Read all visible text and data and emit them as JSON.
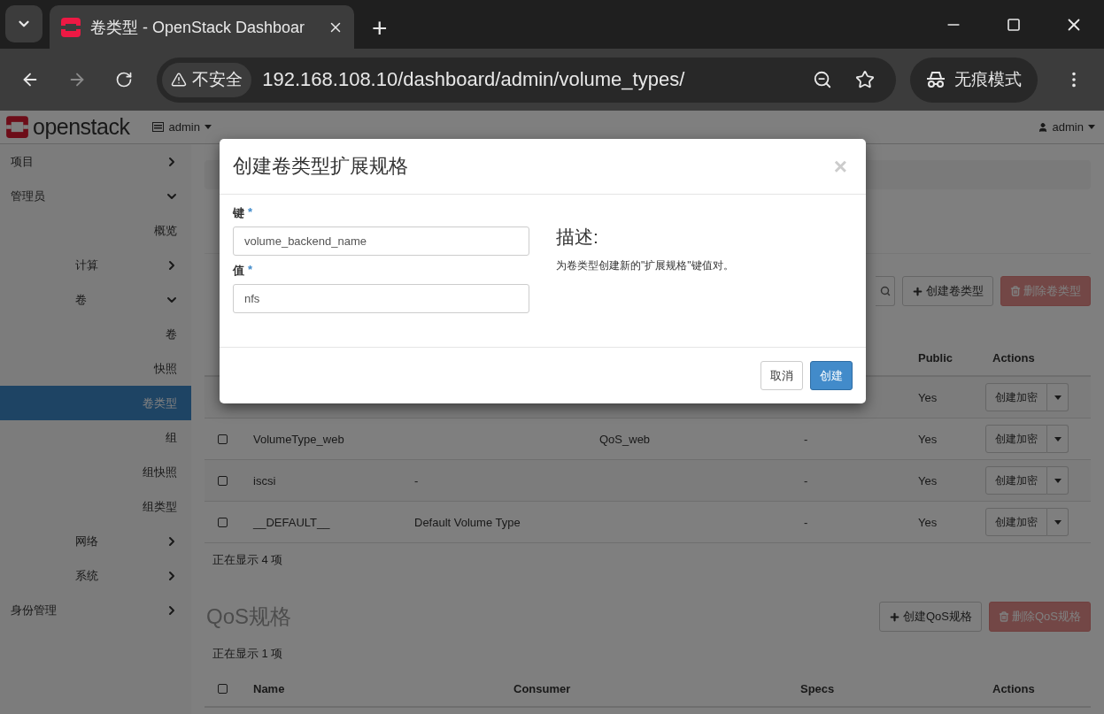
{
  "browser": {
    "tab_title": "卷类型 - OpenStack Dashboar",
    "new_tab": "+",
    "address_warning": "不安全",
    "url": "192.168.108.10/dashboard/admin/volume_types/",
    "incognito": "无痕模式"
  },
  "header": {
    "logo": "openstack",
    "project": "admin",
    "user": "admin"
  },
  "sidebar": {
    "items": [
      {
        "label": "项目",
        "expanded": false
      },
      {
        "label": "管理员",
        "expanded": true,
        "children": [
          {
            "label": "概览",
            "selected": false
          },
          {
            "label": "计算",
            "expanded": false
          },
          {
            "label": "卷",
            "expanded": true,
            "children": [
              {
                "label": "卷",
                "selected": false
              },
              {
                "label": "快照",
                "selected": false
              },
              {
                "label": "卷类型",
                "selected": true
              },
              {
                "label": "组",
                "selected": false
              },
              {
                "label": "组快照",
                "selected": false
              },
              {
                "label": "组类型",
                "selected": false
              }
            ]
          },
          {
            "label": "网络",
            "expanded": false
          },
          {
            "label": "系统",
            "expanded": false
          }
        ]
      },
      {
        "label": "身份管理",
        "expanded": false
      }
    ]
  },
  "page": {
    "volume_types": {
      "buttons": [
        {
          "label": "创建卷类型",
          "kind": "create",
          "disabled": false
        },
        {
          "label": "删除卷类型",
          "kind": "delete",
          "disabled": true
        }
      ],
      "header": {
        "public": "Public",
        "actions": "Actions"
      },
      "rows": [
        {
          "public": "Yes",
          "action": "创建加密"
        },
        {
          "checked": false,
          "name": "VolumeType_web",
          "qos": "QoS_web",
          "encryption": "-",
          "public": "Yes",
          "action": "创建加密"
        },
        {
          "checked": false,
          "name": "iscsi",
          "description": "-",
          "encryption": "-",
          "public": "Yes",
          "action": "创建加密"
        },
        {
          "checked": false,
          "name": "__DEFAULT__",
          "description": "Default Volume Type",
          "encryption": "-",
          "public": "Yes",
          "action": "创建加密"
        }
      ],
      "count": "正在显示 4 项"
    },
    "qos_specs": {
      "heading": "QoS规格",
      "buttons": [
        {
          "label": "创建QoS规格",
          "kind": "create",
          "disabled": false
        },
        {
          "label": "删除QoS规格",
          "kind": "delete",
          "disabled": true
        }
      ],
      "count": "正在显示 1 项",
      "header": {
        "checked": false,
        "name": "Name",
        "consumer": "Consumer",
        "specs": "Specs",
        "actions": "Actions"
      }
    }
  },
  "modal": {
    "title": "创建卷类型扩展规格",
    "close": "×",
    "fields": [
      {
        "label": "键",
        "required_mark": "*",
        "value": "volume_backend_name"
      },
      {
        "label": "值",
        "required_mark": "*",
        "value": "nfs"
      }
    ],
    "description_heading": "描述:",
    "description": "为卷类型创建新的\"扩展规格\"键值对。",
    "buttons": [
      {
        "label": "取消",
        "kind": "default"
      },
      {
        "label": "创建",
        "kind": "primary"
      }
    ]
  }
}
